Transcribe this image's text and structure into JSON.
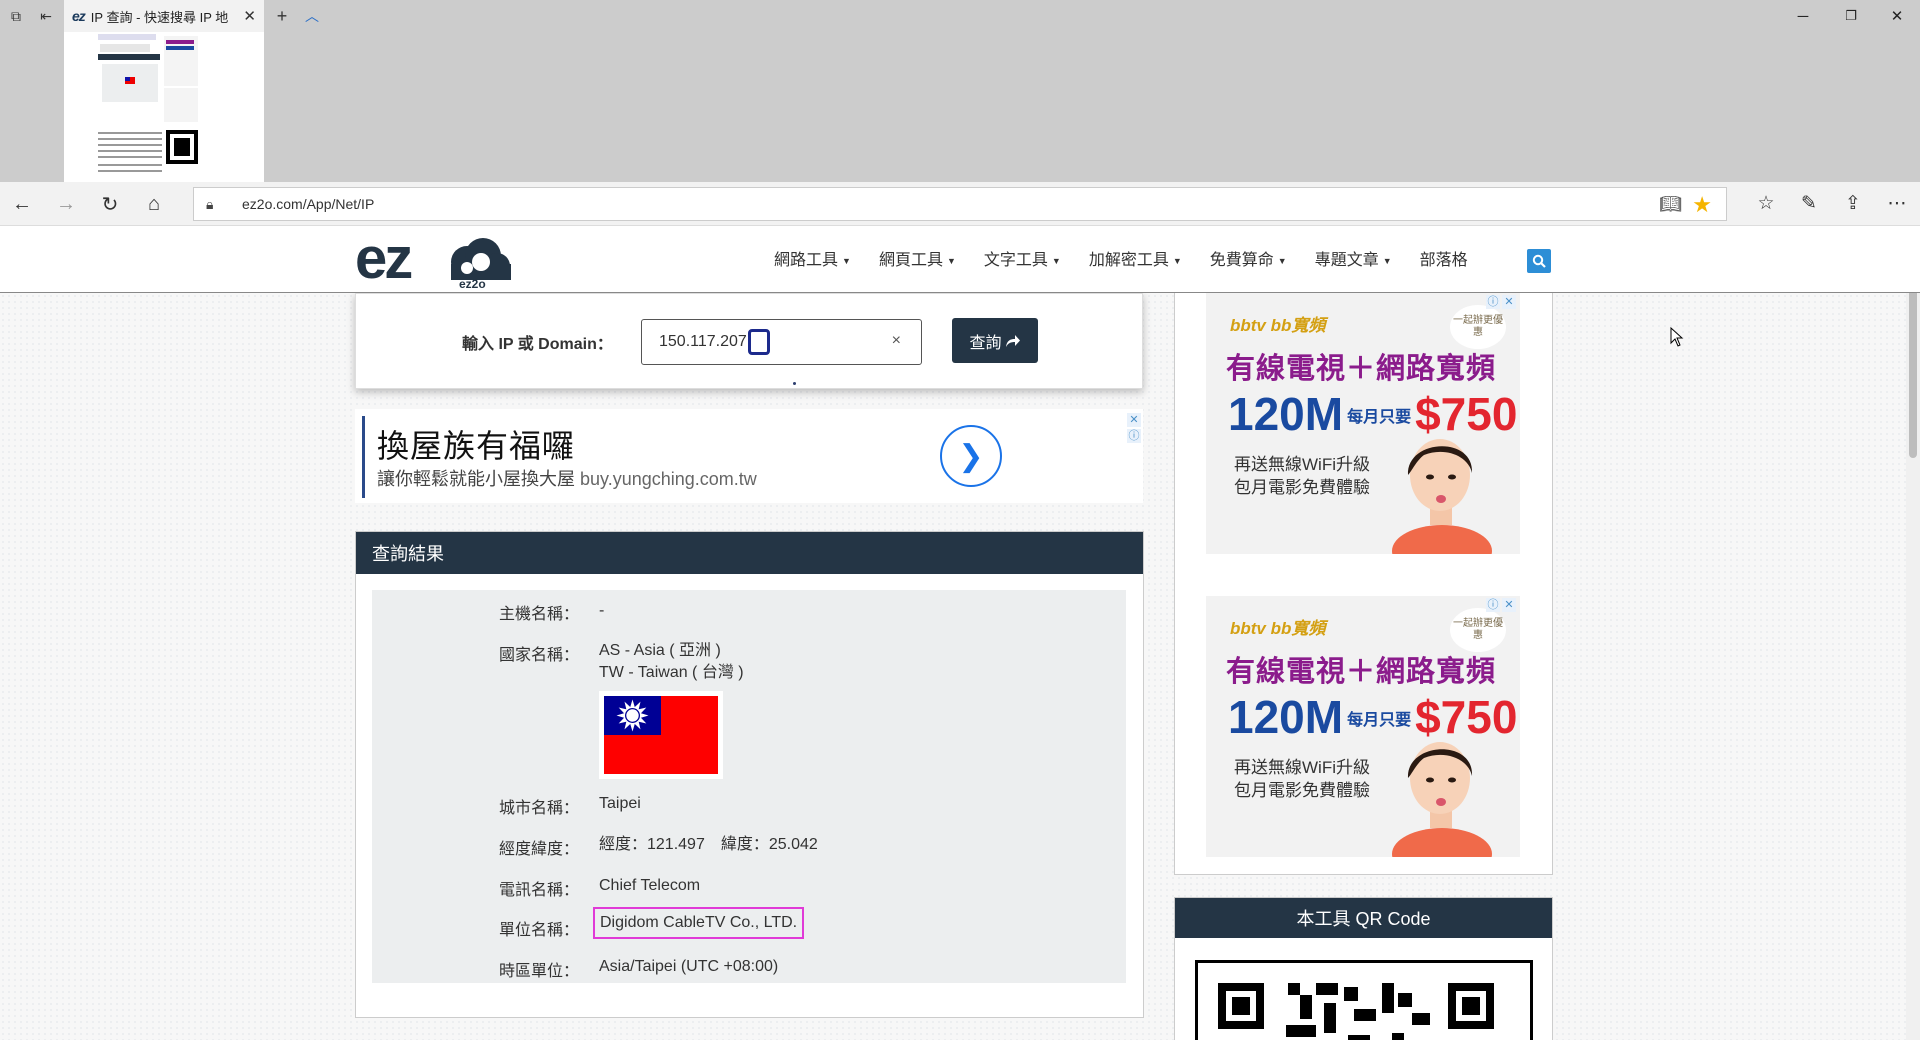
{
  "browser": {
    "tab": {
      "favicon_text": "ez",
      "title": "IP 查詢 - 快速搜尋 IP 地"
    },
    "url": "ez2o.com/App/Net/IP"
  },
  "site": {
    "logo_text": "ez2o",
    "menu": [
      {
        "label": "網路工具",
        "has_caret": true
      },
      {
        "label": "網頁工具",
        "has_caret": true
      },
      {
        "label": "文字工具",
        "has_caret": true
      },
      {
        "label": "加解密工具",
        "has_caret": true
      },
      {
        "label": "免費算命",
        "has_caret": true
      },
      {
        "label": "專題文章",
        "has_caret": true
      },
      {
        "label": "部落格",
        "has_caret": false
      }
    ]
  },
  "query": {
    "label": "輸入 IP 或 Domain：",
    "value": "150.117.207",
    "clear_symbol": "×",
    "button_label": "查詢"
  },
  "text_ad": {
    "headline": "換屋族有福囉",
    "subline": "讓你輕鬆就能小屋換大屋",
    "domain": "buy.yungching.com.tw"
  },
  "result": {
    "title": "查詢結果",
    "host_label": "主機名稱：",
    "host_value": "-",
    "country_label": "國家名稱：",
    "continent_value": "AS - Asia ( 亞洲 )",
    "country_value": "TW - Taiwan ( 台灣 )",
    "city_label": "城市名稱：",
    "city_value": "Taipei",
    "coords_label": "經度緯度：",
    "coords_value": "經度：121.497　緯度：25.042",
    "isp_label": "電訊名稱：",
    "isp_value": "Chief Telecom",
    "org_label": "單位名稱：",
    "org_value": "Digidom CableTV Co., LTD.",
    "tz_label": "時區單位：",
    "tz_value": "Asia/Taipei (UTC +08:00)"
  },
  "side_ad": {
    "brand": "bbtv bb寬頻",
    "bubble": "一起辦更優惠",
    "line1": "有線電視＋網路寬頻",
    "speed": "120M",
    "monthly": "每月只要",
    "price": "$750",
    "line3": "再送無線WiFi升級",
    "line4": "包月電影免費體驗"
  },
  "qr": {
    "title": "本工具 QR Code"
  },
  "colors": {
    "header_dark": "#243545",
    "accent_blue": "#2d8ed6",
    "highlight": "#e03ad7"
  }
}
